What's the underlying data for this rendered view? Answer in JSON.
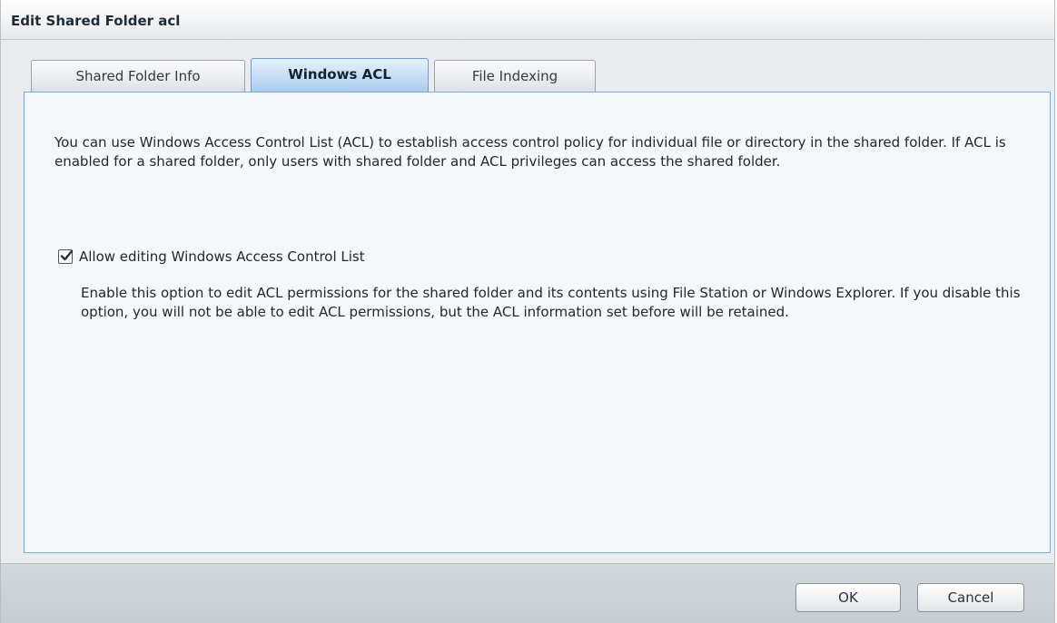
{
  "window": {
    "title": "Edit Shared Folder acl"
  },
  "tabs": [
    {
      "label": "Shared Folder Info",
      "active": false
    },
    {
      "label": "Windows ACL",
      "active": true
    },
    {
      "label": "File Indexing",
      "active": false
    }
  ],
  "panel": {
    "intro": "You can use Windows Access Control List (ACL) to establish access control policy for individual file or directory in the shared folder. If ACL is enabled for a shared folder, only users with shared folder and ACL privileges can access the shared folder.",
    "option": {
      "label": "Allow editing Windows Access Control List",
      "checked": true,
      "description": "Enable this option to edit ACL permissions for the shared folder and its contents using File Station or Windows Explorer. If you disable this option, you will not be able to edit ACL permissions, but the ACL information set before will be retained."
    }
  },
  "footer": {
    "ok_label": "OK",
    "cancel_label": "Cancel"
  },
  "colors": {
    "active_tab": "#a9cbef",
    "panel_border": "#7ea7d8",
    "footer": "#c6ccd2"
  },
  "icons": {
    "checkbox": "checkmark-icon"
  }
}
